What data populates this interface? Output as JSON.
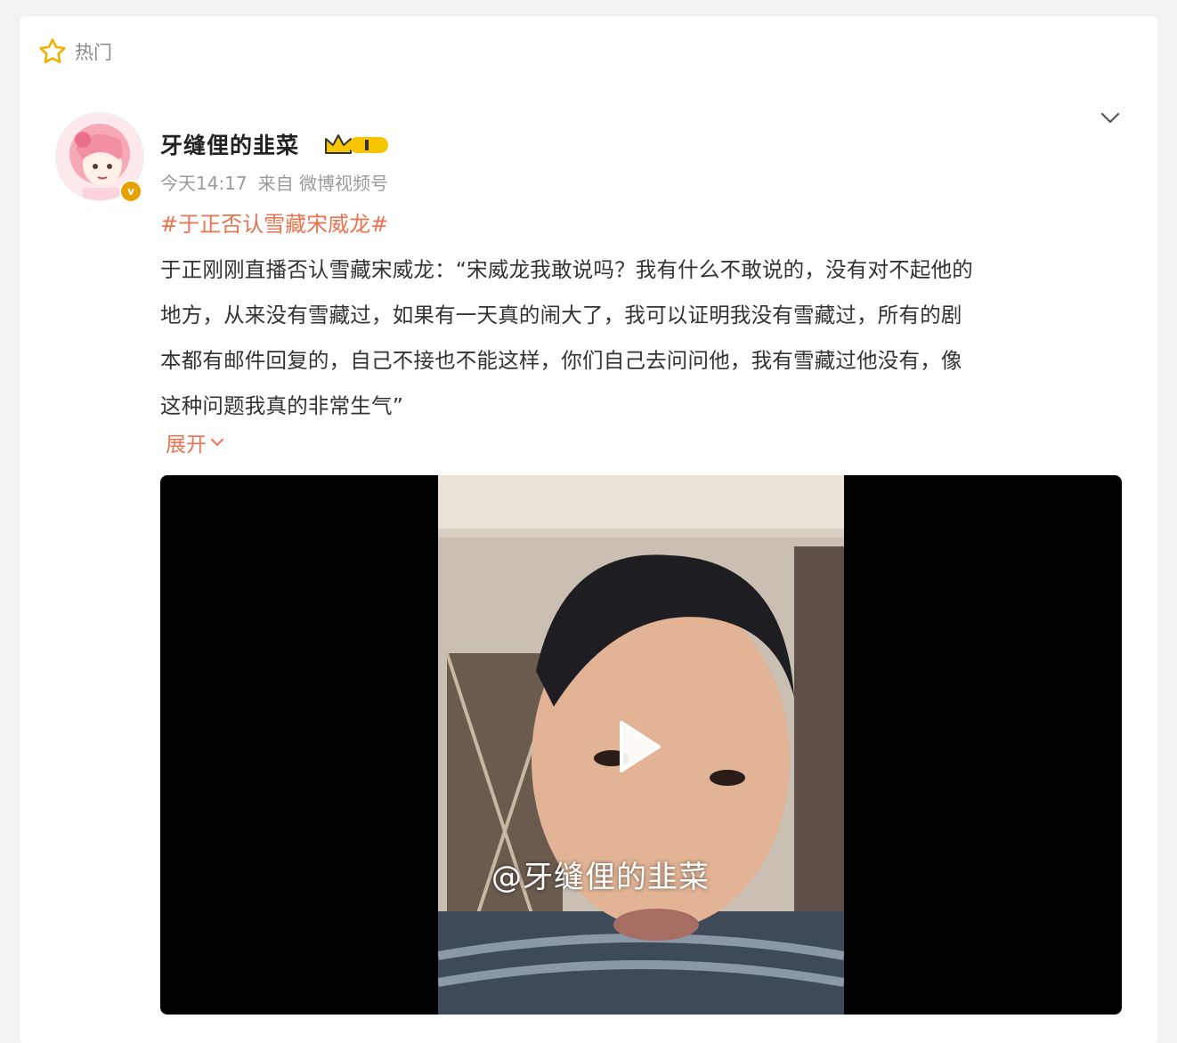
{
  "section": {
    "label": "热门",
    "icon": "star-icon"
  },
  "post": {
    "author": "牙缝俚的韭菜",
    "avatar_icon": "anime-girl-avatar",
    "verified_icon": "verified-v-icon",
    "vip_icon": "crown-vip-badge",
    "time": "今天14:17",
    "source": "来自 微博视频号",
    "hashtag": "#于正否认雪藏宋威龙#",
    "text_lines": [
      "于正刚刚直播否认雪藏宋威龙：“宋威龙我敢说吗？我有什么不敢说的，没有对不起他的",
      "地方，从来没有雪藏过，如果有一天真的闹大了，我可以证明我没有雪藏过，所有的剧",
      "本都有邮件回复的，自己不接也不能这样，你们自己去问问他，我有雪藏过他没有，像",
      "这种问题我真的非常生气”"
    ],
    "expand_label": "展开",
    "video": {
      "watermark": "@牙缝俚的韭菜",
      "play_icon": "play-icon"
    }
  },
  "colors": {
    "accent": "#eb7350",
    "meta": "#9a9a9a",
    "background": "#f2f2f4"
  }
}
